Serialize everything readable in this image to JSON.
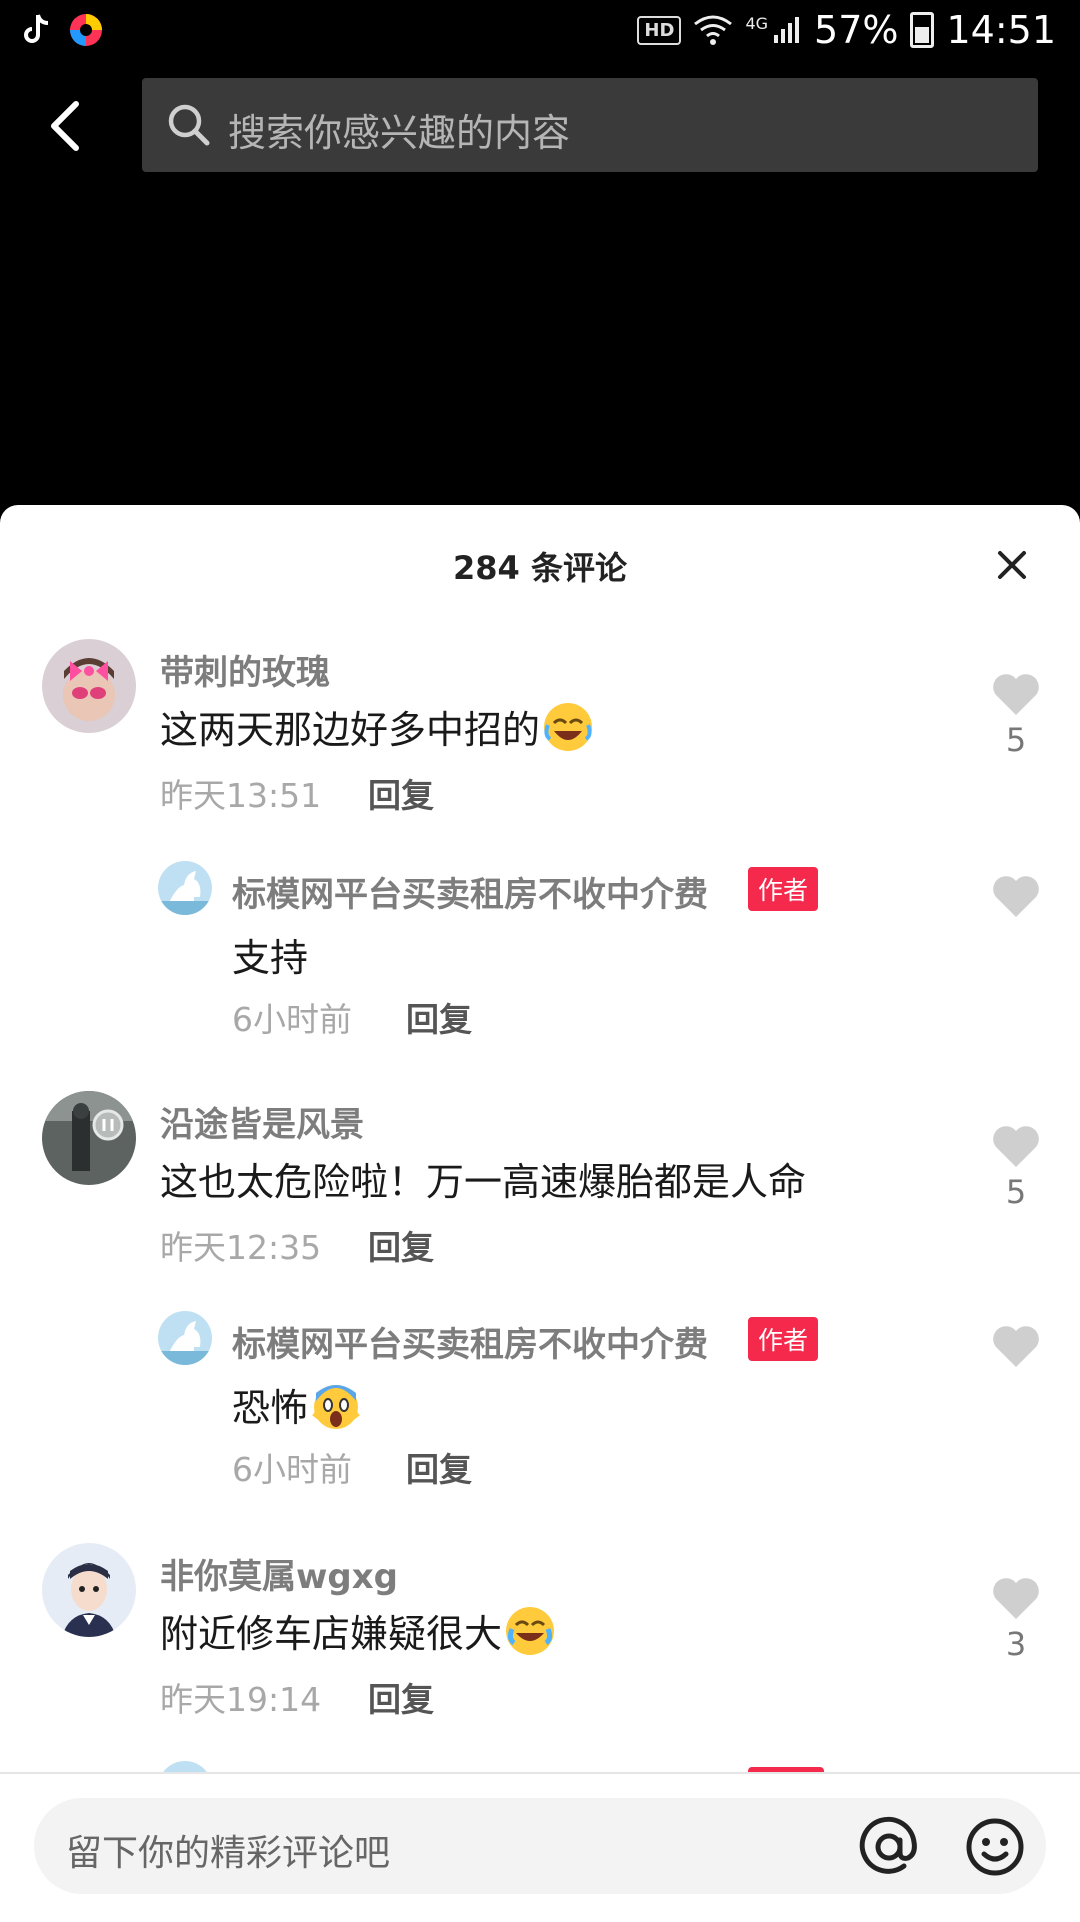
{
  "status_bar": {
    "hd": "HD",
    "network": "4G",
    "battery": "57%",
    "time": "14:51"
  },
  "search": {
    "placeholder": "搜索你感兴趣的内容"
  },
  "comments_header": {
    "title": "284 条评论"
  },
  "comments": [
    {
      "username": "带刺的玫瑰",
      "text": "这两天那边好多中招的",
      "emoji": "laughing-crying-emoji",
      "time": "昨天13:51",
      "reply_label": "回复",
      "likes": "5",
      "reply": {
        "username": "标模网平台买卖租房不收中介费",
        "badge": "作者",
        "text": "支持",
        "time": "6小时前",
        "reply_label": "回复"
      }
    },
    {
      "username": "沿途皆是风景",
      "text": "这也太危险啦！万一高速爆胎都是人命",
      "time": "昨天12:35",
      "reply_label": "回复",
      "likes": "5",
      "reply": {
        "username": "标模网平台买卖租房不收中介费",
        "badge": "作者",
        "text": "恐怖",
        "emoji": "screaming-emoji",
        "time": "6小时前",
        "reply_label": "回复"
      }
    },
    {
      "username": "非你莫属wgxg",
      "text": "附近修车店嫌疑很大",
      "emoji": "crying-laughing-emoji",
      "time": "昨天19:14",
      "reply_label": "回复",
      "likes": "3"
    }
  ],
  "input_bar": {
    "placeholder": "留下你的精彩评论吧"
  },
  "colors": {
    "author_badge": "#f4294b",
    "sheet_bg": "#ffffff",
    "search_bg": "#3a3a3a"
  }
}
